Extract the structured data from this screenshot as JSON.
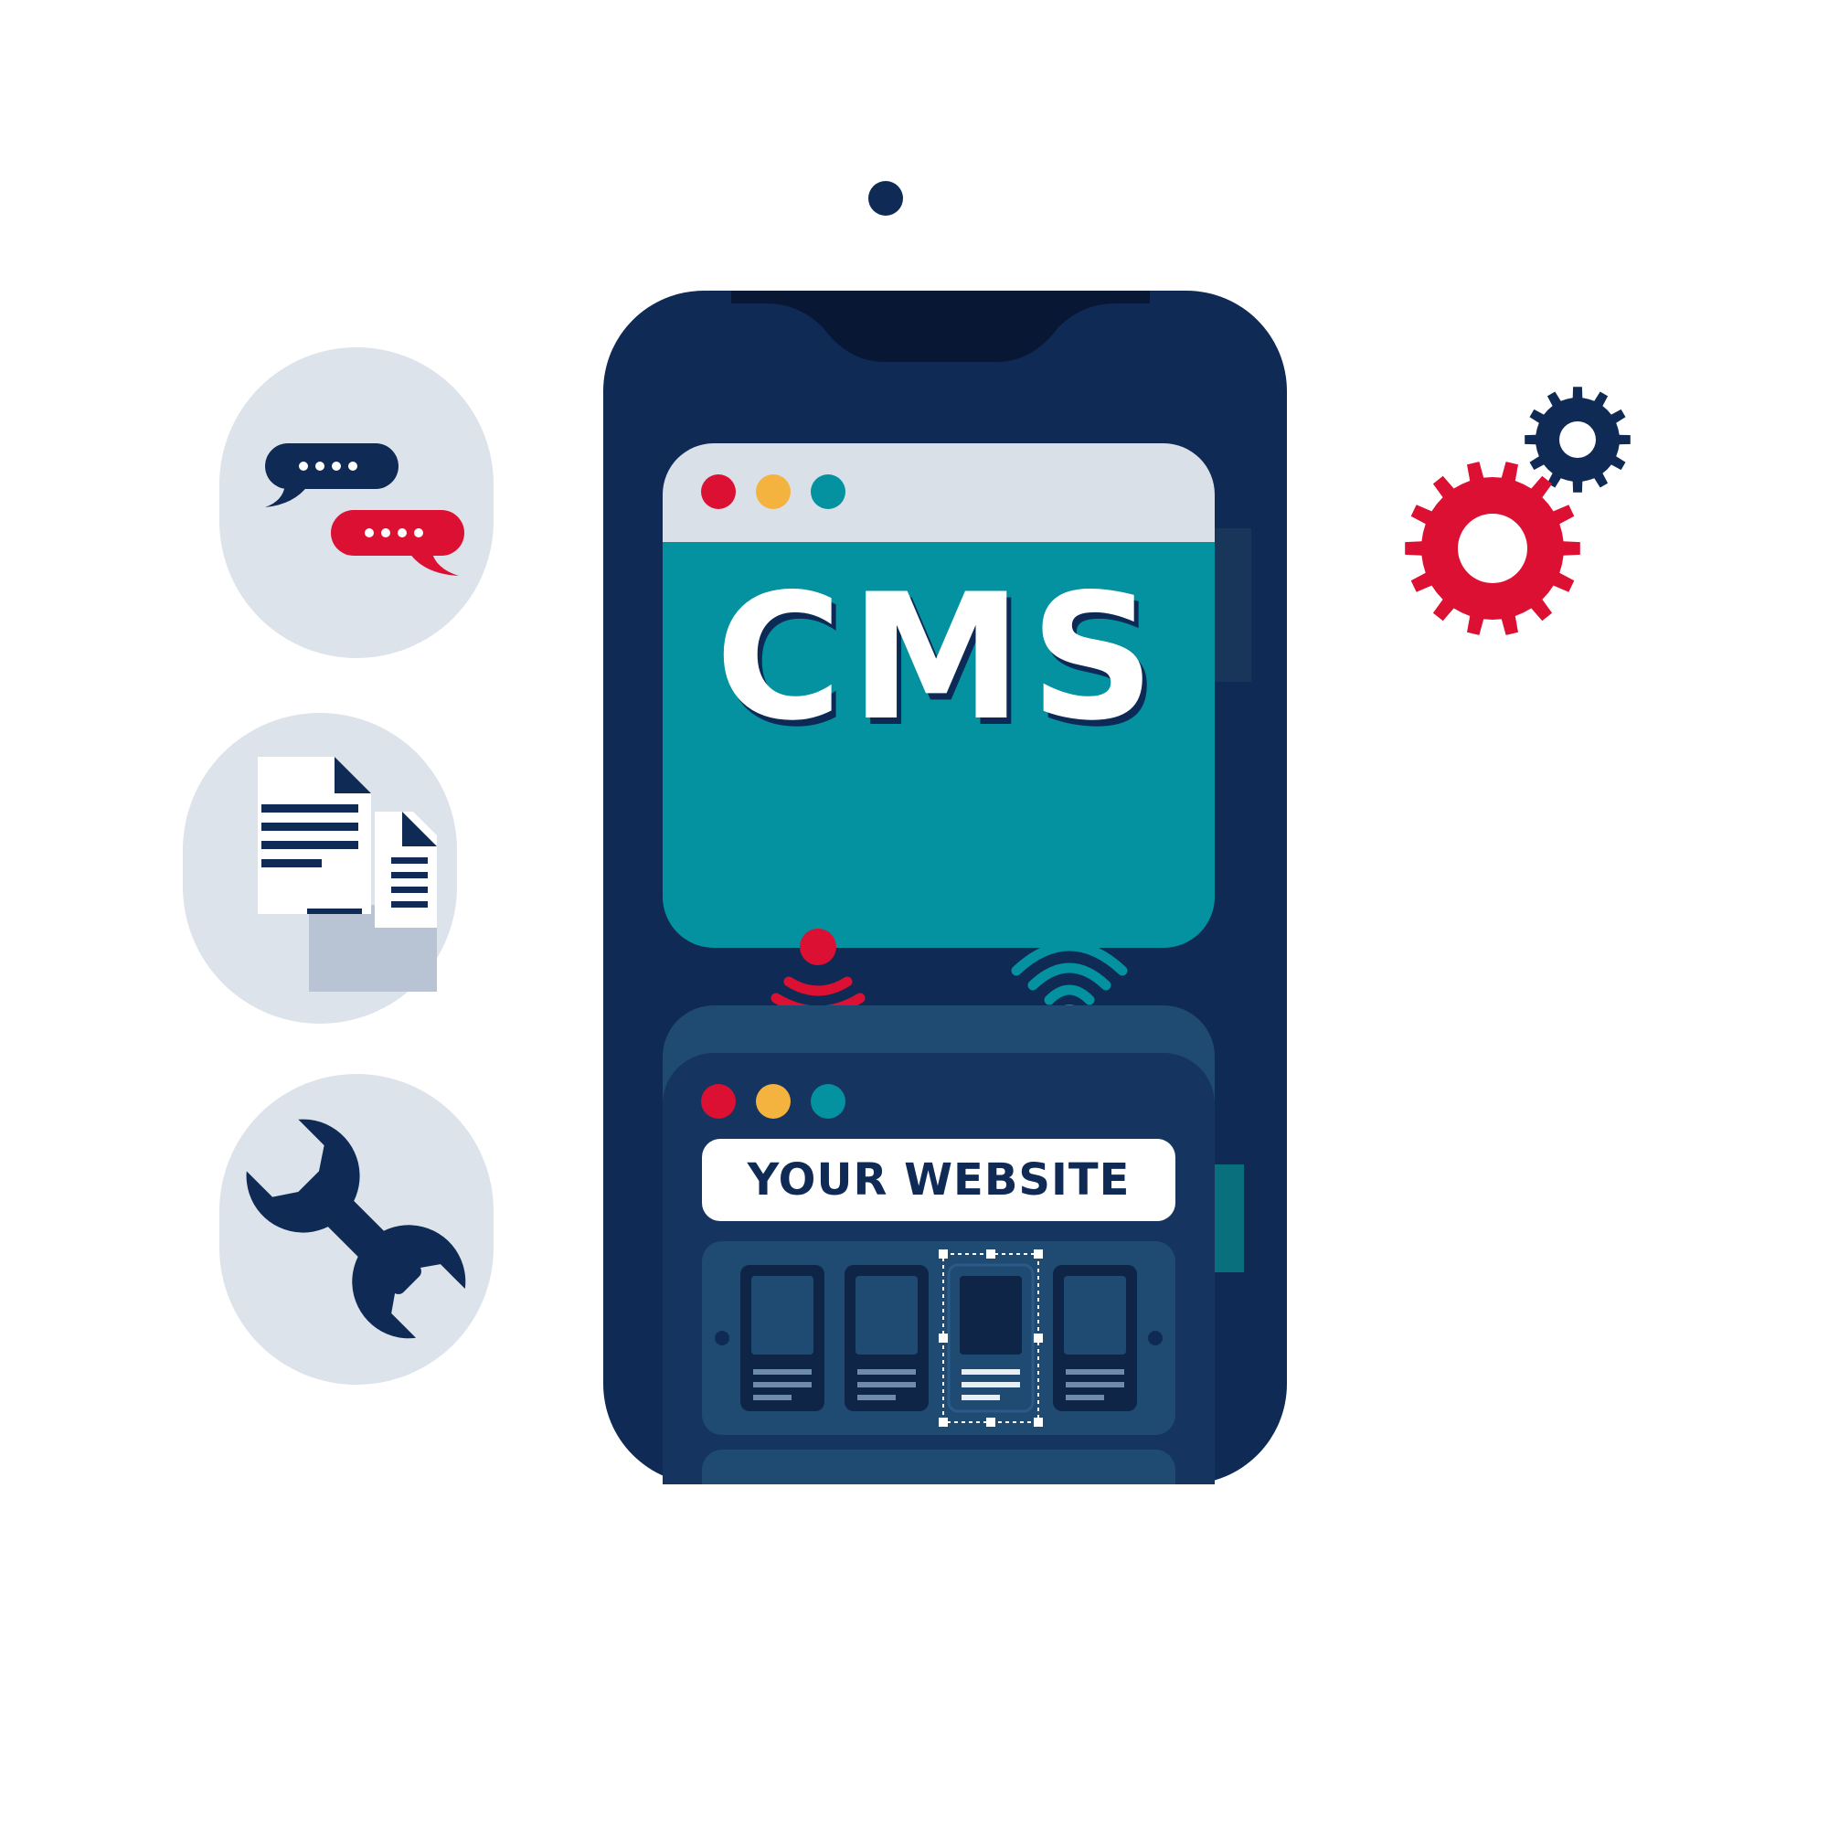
{
  "colors": {
    "navy": "#0f2a55",
    "navy_dark": "#081733",
    "red": "#dc1033",
    "orange": "#f4b23e",
    "teal": "#0491a0",
    "teal_dark": "#0a6f7c",
    "light_gray": "#d9e0e8",
    "slate": "#1f4b73"
  },
  "cms_window": {
    "title": "CMS",
    "window_dots": [
      "red",
      "orange",
      "teal"
    ]
  },
  "website_window": {
    "label": "YOUR WEBSITE",
    "window_dots": [
      "red",
      "orange",
      "teal"
    ],
    "carousel": {
      "slide_count": 4,
      "selected_slide": 3
    }
  },
  "feature_icons": [
    "chat-bubbles-icon",
    "documents-icon",
    "wrench-icon"
  ],
  "decorations": [
    "gears-icon",
    "signal-waves-icon",
    "wifi-icon"
  ]
}
